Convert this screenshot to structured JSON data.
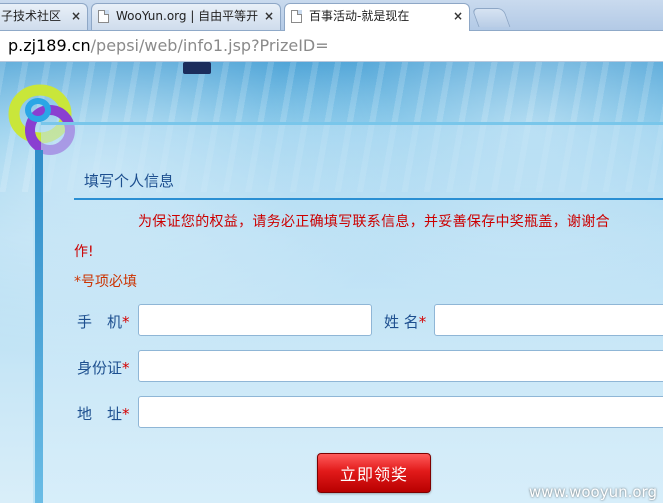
{
  "browser": {
    "tabs": [
      {
        "label": "子技术社区",
        "close": "×",
        "active": false
      },
      {
        "label": "WooYun.org | 自由平等开",
        "close": "×",
        "active": false
      },
      {
        "label": "百事活动-就是现在",
        "close": "×",
        "active": true
      }
    ],
    "url_host": "p.zj189.cn",
    "url_path": "/pepsi/web/info1.jsp?PrizeID="
  },
  "form": {
    "section_title": "填写个人信息",
    "notice_line1": "为保证您的权益，请务必正确填写联系信息，并妥善保存中奖瓶盖，谢谢合",
    "notice_line2": "作!",
    "required_note": "*号项必填",
    "fields": {
      "phone_label": "手　机",
      "name_label": "姓 名",
      "id_label": "身份证",
      "address_label": "地　址",
      "star": "*"
    },
    "submit_label": "立即领奖"
  },
  "watermark": "www.wooyun.org",
  "colors": {
    "accent_red": "#cc0000",
    "label_blue": "#1d4f8f",
    "button_red": "#e21a1a"
  },
  "icons": {
    "tab_icon": "document-icon",
    "logo": "ring-logo"
  }
}
